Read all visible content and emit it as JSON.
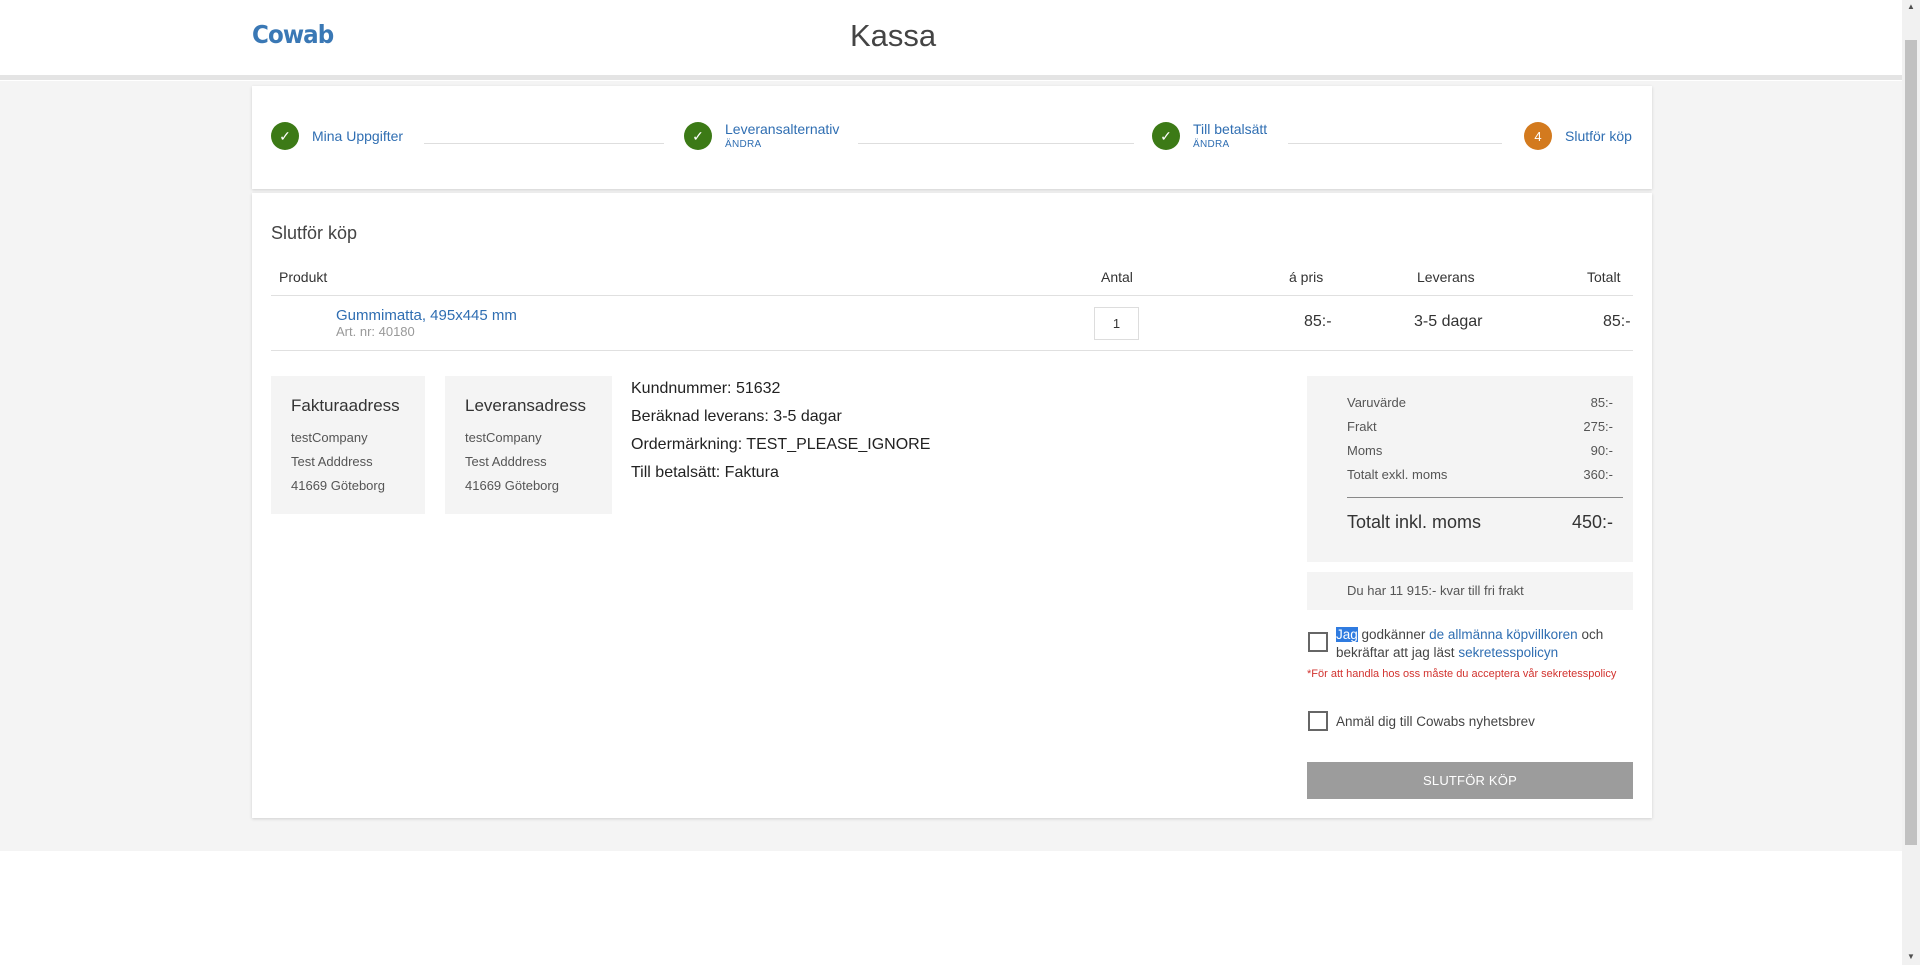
{
  "header": {
    "logo": "Cowab",
    "title": "Kassa"
  },
  "steps": [
    {
      "label": "Mina Uppgifter",
      "change": "",
      "status": "done"
    },
    {
      "label": "Leveransalternativ",
      "change": "ÄNDRA",
      "status": "done"
    },
    {
      "label": "Till betalsätt",
      "change": "ÄNDRA",
      "status": "done"
    },
    {
      "label": "Slutför köp",
      "change": "",
      "number": "4",
      "status": "current"
    }
  ],
  "checkout": {
    "title": "Slutför köp",
    "columns": {
      "product": "Produkt",
      "quantity": "Antal",
      "unit_price": "á pris",
      "delivery": "Leverans",
      "total": "Totalt"
    },
    "item": {
      "name": "Gummimatta, 495x445 mm",
      "art_nr": "Art. nr: 40180",
      "quantity": "1",
      "unit_price": "85:-",
      "delivery": "3-5 dagar",
      "total": "85:-"
    }
  },
  "billing": {
    "title": "Fakturaadress",
    "company": "testCompany",
    "address": "Test Adddress",
    "city": "41669 Göteborg"
  },
  "shipping": {
    "title": "Leveransadress",
    "company": "testCompany",
    "address": "Test Adddress",
    "city": "41669 Göteborg"
  },
  "order_info": {
    "customer_number": "Kundnummer: 51632",
    "estimated_delivery": "Beräknad leverans: 3-5 dagar",
    "order_marking": "Ordermärkning: TEST_PLEASE_IGNORE",
    "payment_method": "Till betalsätt: Faktura"
  },
  "summary": {
    "goods_label": "Varuvärde",
    "goods_value": "85:-",
    "freight_label": "Frakt",
    "freight_value": "275:-",
    "vat_label": "Moms",
    "vat_value": "90:-",
    "excl_vat_label": "Totalt exkl. moms",
    "excl_vat_value": "360:-",
    "total_label": "Totalt inkl. moms",
    "total_value": "450:-"
  },
  "free_shipping": "Du har 11 915:- kvar till fri frakt",
  "terms": {
    "word_highlighted": "Jag",
    "text_1": " godkänner ",
    "link_1": "de allmänna köpvillkoren",
    "text_2": " och bekräftar att jag läst ",
    "link_2": "sekretesspolicyn",
    "error": "*För att handla hos oss måste du acceptera vår sekretesspolicy",
    "checked": false
  },
  "newsletter": {
    "label": "Anmäl dig till Cowabs nyhetsbrev",
    "checked": false
  },
  "submit_label": "SLUTFÖR KÖP",
  "colors": {
    "brand": "#3a78b5",
    "link": "#2f6eb2",
    "step_done": "#3c7a16",
    "step_current": "#d37a1e",
    "error": "#d2332f",
    "button_disabled": "#9c9c9c"
  }
}
